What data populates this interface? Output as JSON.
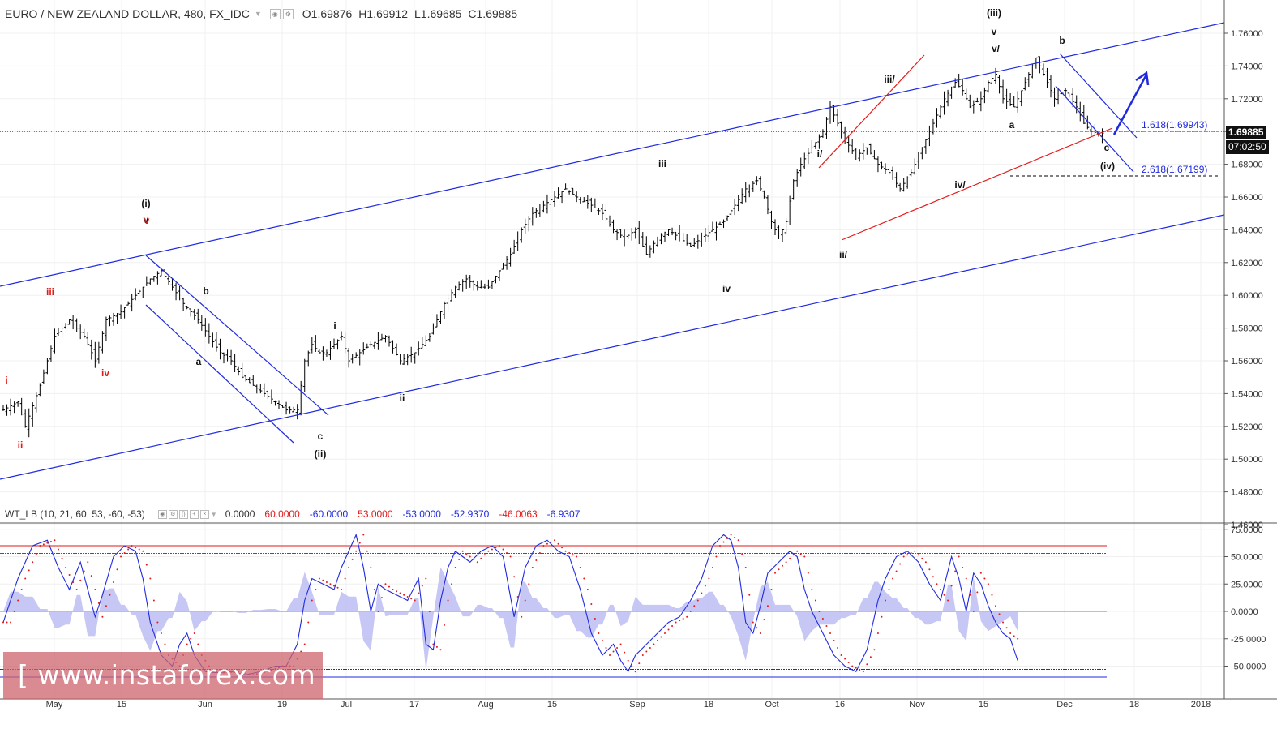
{
  "header": {
    "symbol": "EURO / NEW ZEALAND DOLLAR, 480, FX_IDC",
    "open": "O1.69876",
    "high": "H1.69912",
    "low": "L1.69685",
    "close": "C1.69885"
  },
  "indicator_header": {
    "name": "WT_LB (10, 21, 60, 53, -60, -53)",
    "values": [
      {
        "text": "0.0000",
        "color": "#333333"
      },
      {
        "text": "60.0000",
        "color": "#e21a1a"
      },
      {
        "text": "-60.0000",
        "color": "#1f2ae0"
      },
      {
        "text": "53.0000",
        "color": "#e21a1a"
      },
      {
        "text": "-53.0000",
        "color": "#1f2ae0"
      },
      {
        "text": "-52.9370",
        "color": "#1f2ae0"
      },
      {
        "text": "-46.0063",
        "color": "#e21a1a"
      },
      {
        "text": "-6.9307",
        "color": "#1f2ae0"
      }
    ]
  },
  "price_tags": {
    "last_price": "1.69885",
    "countdown": "07:02:50"
  },
  "watermark": "[ www.instaforex.com ]",
  "fib_labels": [
    "1.618(1.69943)",
    "2.618(1.67199)"
  ],
  "colors": {
    "bars": "#000000",
    "channel": "#1f2ae0",
    "wedge": "#e21a1a",
    "fill": "#b9b9f2",
    "signal": "#e21a1a"
  },
  "chart_data": [
    {
      "type": "ohlc",
      "title": "EURO / NEW ZEALAND DOLLAR, 480, FX_IDC",
      "yticks": [
        "1.76000",
        "1.74000",
        "1.72000",
        "1.70000",
        "1.68000",
        "1.66000",
        "1.64000",
        "1.62000",
        "1.60000",
        "1.58000",
        "1.56000",
        "1.54000",
        "1.52000",
        "1.50000",
        "1.48000",
        "1.46000"
      ],
      "ylim": [
        1.46,
        1.77
      ],
      "xticks": [
        "May",
        "15",
        "Jun",
        "19",
        "Jul",
        "17",
        "Aug",
        "15",
        "Sep",
        "18",
        "Oct",
        "16",
        "Nov",
        "15",
        "Dec",
        "18",
        "2018"
      ],
      "close_path": [
        [
          0,
          1.53
        ],
        [
          4,
          1.535
        ],
        [
          6,
          1.52
        ],
        [
          10,
          1.545
        ],
        [
          14,
          1.575
        ],
        [
          18,
          1.585
        ],
        [
          22,
          1.575
        ],
        [
          25,
          1.56
        ],
        [
          28,
          1.585
        ],
        [
          32,
          1.59
        ],
        [
          36,
          1.6
        ],
        [
          40,
          1.61
        ],
        [
          43,
          1.615
        ],
        [
          46,
          1.605
        ],
        [
          49,
          1.595
        ],
        [
          51,
          1.59
        ],
        [
          53,
          1.585
        ],
        [
          56,
          1.575
        ],
        [
          59,
          1.565
        ],
        [
          62,
          1.56
        ],
        [
          65,
          1.55
        ],
        [
          68,
          1.545
        ],
        [
          71,
          1.54
        ],
        [
          74,
          1.535
        ],
        [
          77,
          1.53
        ],
        [
          80,
          1.53
        ],
        [
          82,
          1.56
        ],
        [
          84,
          1.57
        ],
        [
          86,
          1.565
        ],
        [
          88,
          1.565
        ],
        [
          90,
          1.57
        ],
        [
          92,
          1.575
        ],
        [
          94,
          1.56
        ],
        [
          97,
          1.565
        ],
        [
          100,
          1.57
        ],
        [
          104,
          1.575
        ],
        [
          108,
          1.56
        ],
        [
          112,
          1.565
        ],
        [
          116,
          1.575
        ],
        [
          120,
          1.595
        ],
        [
          123,
          1.605
        ],
        [
          126,
          1.61
        ],
        [
          129,
          1.605
        ],
        [
          132,
          1.605
        ],
        [
          135,
          1.615
        ],
        [
          138,
          1.625
        ],
        [
          141,
          1.64
        ],
        [
          144,
          1.65
        ],
        [
          147,
          1.655
        ],
        [
          150,
          1.66
        ],
        [
          153,
          1.665
        ],
        [
          156,
          1.66
        ],
        [
          160,
          1.655
        ],
        [
          163,
          1.65
        ],
        [
          166,
          1.64
        ],
        [
          169,
          1.635
        ],
        [
          172,
          1.64
        ],
        [
          175,
          1.625
        ],
        [
          178,
          1.635
        ],
        [
          181,
          1.64
        ],
        [
          184,
          1.635
        ],
        [
          187,
          1.63
        ],
        [
          190,
          1.635
        ],
        [
          193,
          1.64
        ],
        [
          196,
          1.645
        ],
        [
          199,
          1.655
        ],
        [
          202,
          1.665
        ],
        [
          205,
          1.67
        ],
        [
          207,
          1.66
        ],
        [
          209,
          1.645
        ],
        [
          211,
          1.635
        ],
        [
          213,
          1.645
        ],
        [
          215,
          1.67
        ],
        [
          217,
          1.68
        ],
        [
          220,
          1.69
        ],
        [
          223,
          1.7
        ],
        [
          225,
          1.715
        ],
        [
          227,
          1.705
        ],
        [
          229,
          1.695
        ],
        [
          232,
          1.685
        ],
        [
          235,
          1.69
        ],
        [
          238,
          1.68
        ],
        [
          241,
          1.675
        ],
        [
          244,
          1.665
        ],
        [
          247,
          1.675
        ],
        [
          250,
          1.69
        ],
        [
          253,
          1.705
        ],
        [
          256,
          1.72
        ],
        [
          259,
          1.73
        ],
        [
          261,
          1.725
        ],
        [
          263,
          1.715
        ],
        [
          266,
          1.72
        ],
        [
          268,
          1.73
        ],
        [
          270,
          1.735
        ],
        [
          272,
          1.72
        ],
        [
          275,
          1.715
        ],
        [
          278,
          1.73
        ],
        [
          281,
          1.745
        ],
        [
          283,
          1.735
        ],
        [
          286,
          1.72
        ],
        [
          289,
          1.725
        ],
        [
          292,
          1.715
        ],
        [
          294,
          1.705
        ],
        [
          296,
          1.7
        ],
        [
          298,
          1.699
        ]
      ]
    },
    {
      "type": "line",
      "title": "WT_LB (10, 21, 60, 53, -60, -53)",
      "yticks": [
        "75.0000",
        "50.0000",
        "25.0000",
        "0.0000",
        "-25.0000",
        "-50.0000"
      ],
      "ylim": [
        -62,
        78
      ],
      "levels": [
        60,
        53,
        0,
        -53,
        -60
      ],
      "wt1_path": [
        [
          0,
          -10
        ],
        [
          4,
          30
        ],
        [
          8,
          60
        ],
        [
          12,
          65
        ],
        [
          15,
          40
        ],
        [
          18,
          20
        ],
        [
          21,
          45
        ],
        [
          23,
          20
        ],
        [
          25,
          -5
        ],
        [
          27,
          15
        ],
        [
          30,
          50
        ],
        [
          33,
          60
        ],
        [
          36,
          55
        ],
        [
          38,
          30
        ],
        [
          40,
          -10
        ],
        [
          43,
          -40
        ],
        [
          46,
          -50
        ],
        [
          48,
          -30
        ],
        [
          50,
          -20
        ],
        [
          52,
          -40
        ],
        [
          55,
          -55
        ],
        [
          58,
          -56
        ],
        [
          62,
          -55
        ],
        [
          66,
          -58
        ],
        [
          70,
          -55
        ],
        [
          74,
          -50
        ],
        [
          77,
          -50
        ],
        [
          80,
          -30
        ],
        [
          82,
          10
        ],
        [
          84,
          30
        ],
        [
          87,
          25
        ],
        [
          90,
          20
        ],
        [
          92,
          40
        ],
        [
          94,
          55
        ],
        [
          96,
          70
        ],
        [
          98,
          40
        ],
        [
          100,
          0
        ],
        [
          102,
          25
        ],
        [
          104,
          20
        ],
        [
          107,
          15
        ],
        [
          110,
          10
        ],
        [
          113,
          30
        ],
        [
          115,
          -30
        ],
        [
          117,
          -35
        ],
        [
          119,
          10
        ],
        [
          121,
          40
        ],
        [
          123,
          55
        ],
        [
          125,
          50
        ],
        [
          127,
          45
        ],
        [
          130,
          55
        ],
        [
          133,
          60
        ],
        [
          136,
          50
        ],
        [
          139,
          -5
        ],
        [
          142,
          40
        ],
        [
          145,
          60
        ],
        [
          148,
          65
        ],
        [
          151,
          55
        ],
        [
          154,
          50
        ],
        [
          157,
          20
        ],
        [
          160,
          -20
        ],
        [
          163,
          -40
        ],
        [
          166,
          -30
        ],
        [
          168,
          -45
        ],
        [
          170,
          -55
        ],
        [
          172,
          -40
        ],
        [
          175,
          -30
        ],
        [
          178,
          -20
        ],
        [
          181,
          -10
        ],
        [
          184,
          -5
        ],
        [
          187,
          10
        ],
        [
          190,
          30
        ],
        [
          193,
          60
        ],
        [
          196,
          70
        ],
        [
          198,
          65
        ],
        [
          200,
          40
        ],
        [
          202,
          -10
        ],
        [
          204,
          -20
        ],
        [
          206,
          5
        ],
        [
          208,
          35
        ],
        [
          211,
          45
        ],
        [
          214,
          55
        ],
        [
          216,
          50
        ],
        [
          218,
          20
        ],
        [
          220,
          0
        ],
        [
          223,
          -20
        ],
        [
          226,
          -40
        ],
        [
          229,
          -50
        ],
        [
          232,
          -55
        ],
        [
          235,
          -35
        ],
        [
          238,
          10
        ],
        [
          240,
          30
        ],
        [
          243,
          50
        ],
        [
          246,
          55
        ],
        [
          249,
          45
        ],
        [
          252,
          25
        ],
        [
          255,
          10
        ],
        [
          258,
          50
        ],
        [
          260,
          30
        ],
        [
          262,
          0
        ],
        [
          264,
          35
        ],
        [
          266,
          25
        ],
        [
          268,
          5
        ],
        [
          270,
          -10
        ],
        [
          272,
          -20
        ],
        [
          274,
          -25
        ],
        [
          276,
          -45
        ]
      ]
    }
  ],
  "wave_labels": {
    "black": [
      "(i)",
      "v",
      "b",
      "a",
      "c",
      "(ii)",
      "i",
      "ii",
      "iii",
      "iv",
      "i/",
      "ii/",
      "iii/",
      "iv/",
      "(iii)",
      "v",
      "v/",
      "b",
      "a",
      "c",
      "(iv)"
    ],
    "red": [
      "iii",
      "iv",
      "i",
      "ii",
      "v"
    ]
  }
}
